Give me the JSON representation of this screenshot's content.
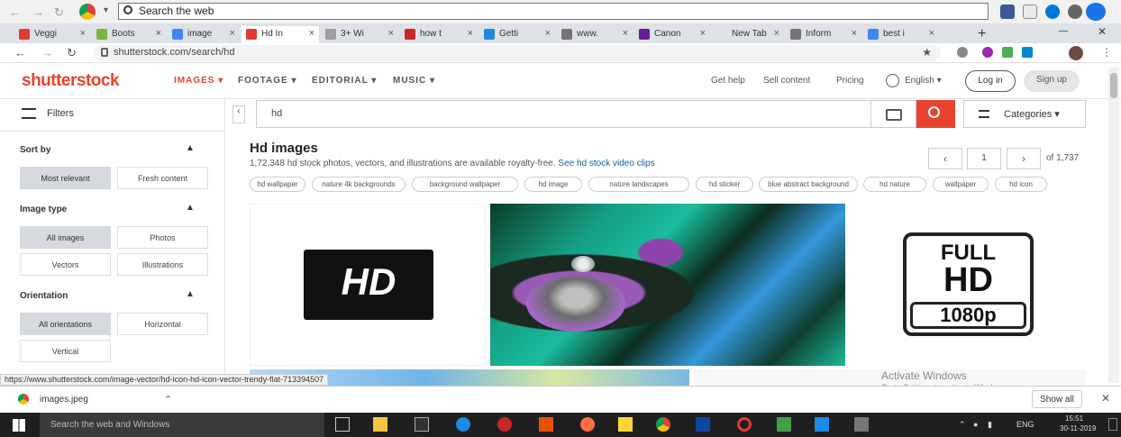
{
  "browser": {
    "search_placeholder": "Search the web",
    "tabs": [
      {
        "label": "Veggi",
        "color": "#e53935"
      },
      {
        "label": "Boots",
        "color": "#7cb342"
      },
      {
        "label": "image",
        "color": "#4285f4"
      },
      {
        "label": "Hd In",
        "color": "#e53935"
      },
      {
        "label": "3+ Wi",
        "color": "#9e9e9e"
      },
      {
        "label": "how t",
        "color": "#c62828"
      },
      {
        "label": "Getti",
        "color": "#1e88e5"
      },
      {
        "label": "www.",
        "color": "#757575"
      },
      {
        "label": "Canon",
        "color": "#6a1b9a"
      },
      {
        "label": "New Tab",
        "color": ""
      },
      {
        "label": "Inform",
        "color": "#757575"
      },
      {
        "label": "best i",
        "color": "#4285f4"
      }
    ],
    "new_tab_label": "+",
    "address": "shutterstock.com/search/hd"
  },
  "site": {
    "logo": "shutterstock",
    "nav": [
      "IMAGES",
      "FOOTAGE",
      "EDITORIAL",
      "MUSIC"
    ],
    "get_help": "Get help",
    "sell_content": "Sell content",
    "pricing": "Pricing",
    "language": "English",
    "login": "Log in",
    "signup": "Sign up",
    "accent": "#e8432f"
  },
  "sidebar": {
    "filters_label": "Filters",
    "sort_by": "Sort by",
    "sort_options": [
      "Most relevant",
      "Fresh content"
    ],
    "image_type": "Image type",
    "type_options": [
      "All images",
      "Photos",
      "Vectors",
      "Illustrations"
    ],
    "orientation": "Orientation",
    "orientation_options": [
      "All orientations",
      "Horizontal",
      "Vertical"
    ]
  },
  "search": {
    "query": "hd",
    "categories_label": "Categories"
  },
  "results": {
    "title": "Hd images",
    "subtitle": "1,72,348 hd stock photos, vectors, and illustrations are available royalty-free.",
    "video_link": "See hd stock video clips",
    "page_current": "1",
    "page_total": "of 1,737",
    "chips": [
      "hd wallpaper",
      "nature 4k backgrounds",
      "background wallpaper",
      "hd image",
      "nature landscapes",
      "hd sticker",
      "blue abstract background",
      "hd nature",
      "wallpaper",
      "hd icon"
    ],
    "hd_logo_text": "HD",
    "fullhd_line1": "FULL",
    "fullhd_line2": "HD",
    "fullhd_line3": "1080p"
  },
  "status": {
    "hover_url": "https://www.shutterstock.com/image-vector/hd-icon-hd-icon-vector-trendy-flat-713394507"
  },
  "download_bar": {
    "file": "images.jpeg",
    "show_all": "Show all"
  },
  "watermark": {
    "line1": "Activate Windows",
    "line2": "Go to Settings to activate Windows."
  },
  "taskbar": {
    "search_placeholder": "Search the web and Windows",
    "time": "15:51",
    "date": "30-11-2019",
    "lang": "ENG"
  }
}
